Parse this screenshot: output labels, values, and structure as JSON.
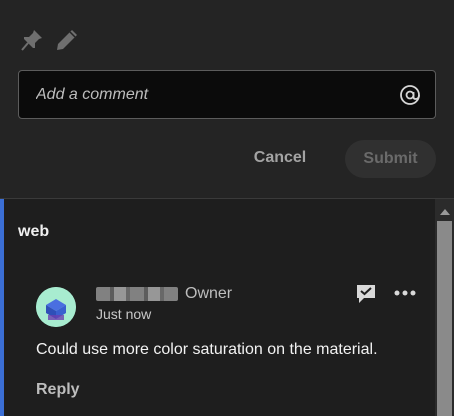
{
  "compose": {
    "input_placeholder": "Add a comment",
    "cancel_label": "Cancel",
    "submit_label": "Submit",
    "icons": [
      "pin-icon",
      "pencil-icon",
      "at-mention-icon"
    ]
  },
  "thread": {
    "group_title": "web",
    "comment": {
      "author_name_redacted": true,
      "author_role": "Owner",
      "timestamp": "Just now",
      "text": "Could use more color saturation on the material.",
      "reply_label": "Reply",
      "icons": [
        "resolve-icon",
        "more-options-icon"
      ]
    }
  },
  "colors": {
    "accent": "#3b6fd6",
    "background": "#242424",
    "panel": "#1e1e1e"
  }
}
